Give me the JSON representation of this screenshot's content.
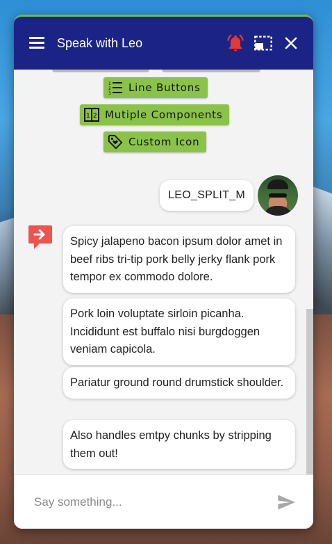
{
  "header": {
    "title": "Speak with Leo",
    "icons": [
      "menu-icon",
      "bell-icon",
      "shrink-window-icon",
      "close-icon"
    ],
    "bell_color": "#e53935",
    "bg_color": "#1c2387"
  },
  "quick_replies": [
    {
      "label": "Line Buttons",
      "icon": "list-icon"
    },
    {
      "label": "Mutiple Components",
      "icon": "components-icon"
    },
    {
      "label": "Custom Icon",
      "icon": "tag-icon"
    }
  ],
  "user_message": {
    "text": "LEO_SPLIT_M",
    "avatar": "user-avatar"
  },
  "bot_messages": [
    "Spicy jalapeno bacon ipsum dolor amet in beef ribs tri-tip pork belly jerky flank pork tempor ex commodo dolore.",
    "Pork loin voluptate sirloin picanha. Incididunt est buffalo nisi burgdoggen veniam capicola.",
    "Pariatur ground round drumstick shoulder.",
    "Also handles emtpy chunks by stripping them out!"
  ],
  "composer": {
    "placeholder": "Say something...",
    "value": ""
  },
  "colors": {
    "accent_green": "#8bc34a",
    "bot_icon": "#ef5350"
  }
}
